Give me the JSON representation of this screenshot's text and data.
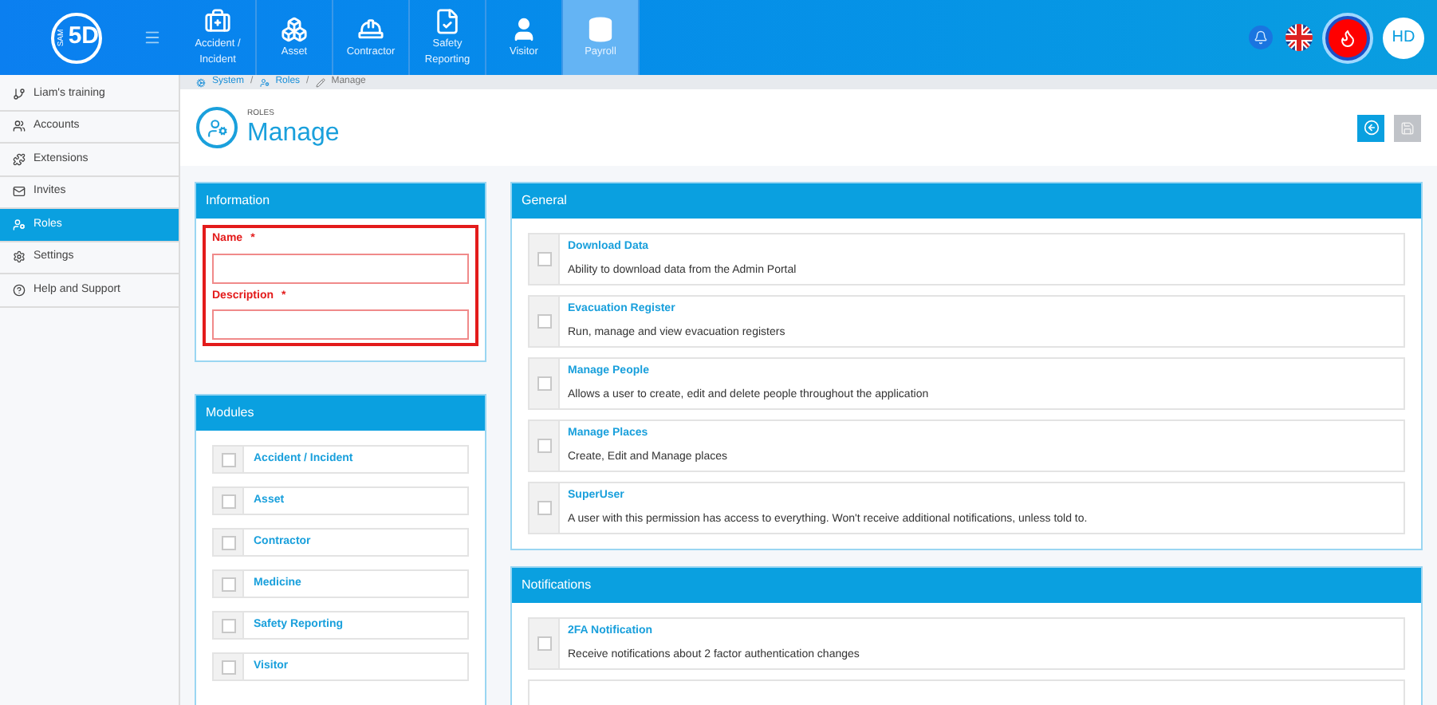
{
  "logo": {
    "text": "5D",
    "subtext": "SAM"
  },
  "nav_tabs": [
    {
      "label": "Accident / Incident",
      "selected": false
    },
    {
      "label": "Asset",
      "selected": false
    },
    {
      "label": "Contractor",
      "selected": false
    },
    {
      "label": "Safety Reporting",
      "selected": false
    },
    {
      "label": "Visitor",
      "selected": false
    },
    {
      "label": "Payroll",
      "selected": true
    }
  ],
  "user": {
    "initials": "HD"
  },
  "sidebar": {
    "items": [
      {
        "label": "Liam's training",
        "selected": false
      },
      {
        "label": "Accounts",
        "selected": false
      },
      {
        "label": "Extensions",
        "selected": false
      },
      {
        "label": "Invites",
        "selected": false
      },
      {
        "label": "Roles",
        "selected": true
      },
      {
        "label": "Settings",
        "selected": false
      },
      {
        "label": "Help and Support",
        "selected": false
      }
    ]
  },
  "breadcrumb": [
    {
      "label": "System",
      "separator": "/"
    },
    {
      "label": "Roles",
      "separator": "/"
    },
    {
      "label": "Manage"
    }
  ],
  "page": {
    "section": "ROLES",
    "title": "Manage"
  },
  "information": {
    "title": "Information",
    "fields": [
      {
        "label": "Name",
        "required_mark": "*"
      },
      {
        "label": "Description",
        "required_mark": "*"
      }
    ]
  },
  "modules": {
    "title": "Modules",
    "items": [
      {
        "label": "Accident / Incident",
        "checked": false
      },
      {
        "label": "Asset",
        "checked": false
      },
      {
        "label": "Contractor",
        "checked": false
      },
      {
        "label": "Medicine",
        "checked": false
      },
      {
        "label": "Safety Reporting",
        "checked": false
      },
      {
        "label": "Visitor",
        "checked": false
      }
    ]
  },
  "general": {
    "title": "General",
    "items": [
      {
        "name": "Download Data",
        "description": "Ability to download data from the Admin Portal",
        "checked": false
      },
      {
        "name": "Evacuation Register",
        "description": "Run, manage and view evacuation registers",
        "checked": false
      },
      {
        "name": "Manage People",
        "description": "Allows a user to create, edit and delete people throughout the application",
        "checked": false
      },
      {
        "name": "Manage Places",
        "description": "Create, Edit and Manage places",
        "checked": false
      },
      {
        "name": "SuperUser",
        "description": "A user with this permission has access to everything. Won't receive additional notifications, unless told to.",
        "checked": false
      }
    ]
  },
  "notifications": {
    "title": "Notifications",
    "items": [
      {
        "name": "2FA Notification",
        "description": "Receive notifications about 2 factor authentication changes",
        "checked": false
      }
    ]
  }
}
